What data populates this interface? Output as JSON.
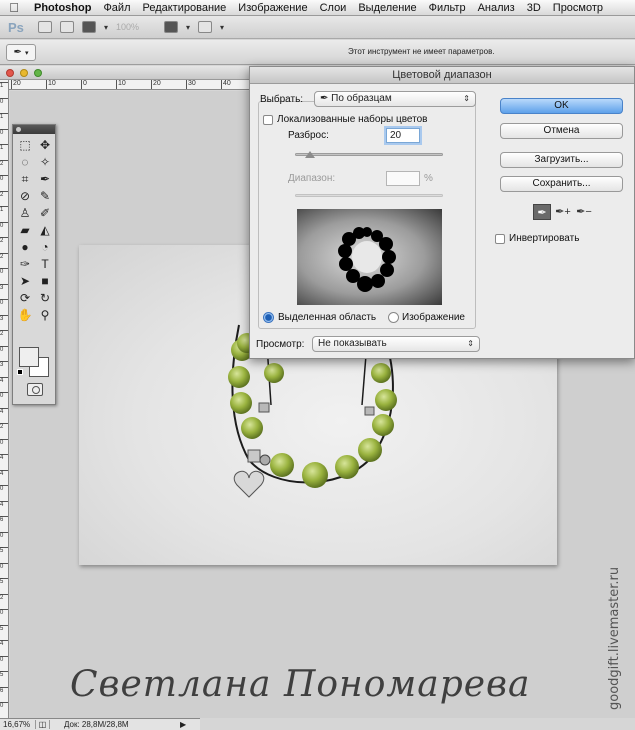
{
  "menubar": {
    "apple": "",
    "items": [
      "Photoshop",
      "Файл",
      "Редактирование",
      "Изображение",
      "Слои",
      "Выделение",
      "Фильтр",
      "Анализ",
      "3D",
      "Просмотр"
    ]
  },
  "appbar": {
    "logo": "Ps",
    "zoom": "100%"
  },
  "options_bar": {
    "tool_icon": "eyedropper-icon",
    "message": "Этот инструмент не имеет параметров."
  },
  "ruler": {
    "top_ticks": [
      "20",
      "10",
      "0",
      "10",
      "20",
      "30",
      "40"
    ],
    "left_ticks": [
      "1",
      "0",
      "1",
      "0",
      "1",
      "2",
      "0",
      "2",
      "1",
      "0",
      "2",
      "2",
      "0",
      "3",
      "0",
      "3",
      "2",
      "0",
      "3",
      "4",
      "0",
      "4",
      "2",
      "0",
      "4",
      "4",
      "0",
      "4",
      "6",
      "0",
      "5",
      "0",
      "5",
      "2",
      "0",
      "5",
      "4",
      "0",
      "5",
      "6",
      "0"
    ]
  },
  "tools": [
    "marquee-icon",
    "move-icon",
    "lasso-icon",
    "magic-wand-icon",
    "crop-icon",
    "eyedropper-icon",
    "healing-brush-icon",
    "brush-icon",
    "clone-stamp-icon",
    "history-brush-icon",
    "eraser-icon",
    "paint-bucket-icon",
    "blur-icon",
    "dodge-icon",
    "pen-icon",
    "type-icon",
    "path-select-icon",
    "shape-icon",
    "3d-rotate-icon",
    "3d-orbit-icon",
    "hand-icon",
    "zoom-icon"
  ],
  "status": {
    "zoom": "16,67%",
    "doc_size": "Док: 28,8M/28,8M"
  },
  "dialog": {
    "title": "Цветовой диапазон",
    "select_label": "Выбрать:",
    "select_value": "По образцам",
    "localized_label": "Локализованные наборы цветов",
    "localized_checked": false,
    "fuzziness_label": "Разброс:",
    "fuzziness_value": "20",
    "fuzziness_position": 0.1,
    "range_label": "Диапазон:",
    "range_value": "",
    "range_unit": "%",
    "radio_selection": "Выделенная область",
    "radio_image": "Изображение",
    "selected_radio": "selection",
    "preview_label": "Просмотр:",
    "preview_value": "Не показывать",
    "invert_label": "Инвертировать",
    "invert_checked": false,
    "buttons": {
      "ok": "OK",
      "cancel": "Отмена",
      "load": "Загрузить...",
      "save": "Сохранить..."
    },
    "eyedroppers": [
      "eyedropper-icon",
      "eyedropper-plus-icon",
      "eyedropper-minus-icon"
    ]
  },
  "watermark": {
    "signature": "Светлана Пономарева",
    "site": "goodgift.livemaster.ru"
  },
  "colors": {
    "ok_button": "#5ea1ea",
    "bead_green": "#9ab33f",
    "accent_focus": "#a9c9ee"
  }
}
